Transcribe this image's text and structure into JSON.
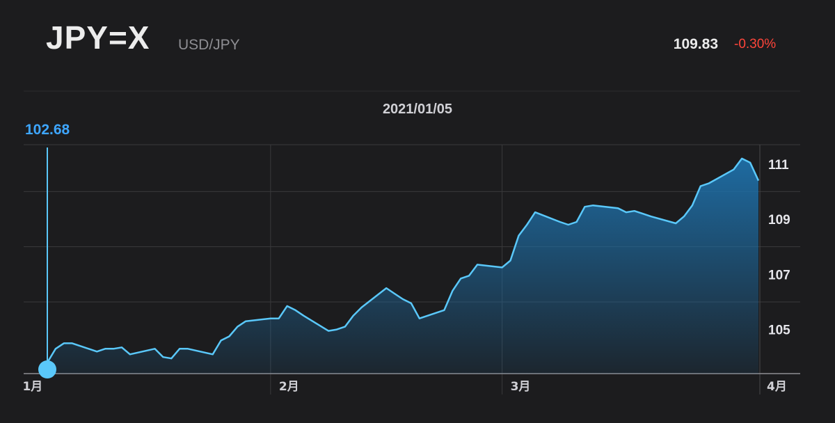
{
  "header": {
    "ticker": "JPY=X",
    "pair": "USD/JPY",
    "price": "109.83",
    "change": "-0.30%"
  },
  "selection": {
    "date": "2021/01/05",
    "value": "102.68"
  },
  "colors": {
    "background": "#1c1c1e",
    "line": "#5ac8fa",
    "fill": "#1e6fa8",
    "marker": "#5ac8fa",
    "negative": "#ff453a",
    "selected_value": "#3ea6ff",
    "grid": "#3a3a3c"
  },
  "chart_data": {
    "type": "area",
    "ylim": [
      103.4,
      111.6
    ],
    "yticks": [
      105,
      107,
      109,
      111
    ],
    "ytick_labels": [
      "105",
      "107",
      "109",
      "111"
    ],
    "xtick_labels": [
      "1月",
      "2月",
      "3月",
      "4月"
    ],
    "xtick_dates": [
      "2021-01-01",
      "2021-02-01",
      "2021-03-01",
      "2021-04-01"
    ],
    "grid": true,
    "legend": "none",
    "series": [
      {
        "x": [
          "2021-01-05",
          "2021-01-06",
          "2021-01-07",
          "2021-01-08",
          "2021-01-11",
          "2021-01-12",
          "2021-01-13",
          "2021-01-14",
          "2021-01-15",
          "2021-01-18",
          "2021-01-19",
          "2021-01-20",
          "2021-01-21",
          "2021-01-22",
          "2021-01-25",
          "2021-01-26",
          "2021-01-27",
          "2021-01-28",
          "2021-01-29",
          "2021-02-01",
          "2021-02-02",
          "2021-02-03",
          "2021-02-04",
          "2021-02-05",
          "2021-02-08",
          "2021-02-09",
          "2021-02-10",
          "2021-02-11",
          "2021-02-12",
          "2021-02-15",
          "2021-02-16",
          "2021-02-17",
          "2021-02-18",
          "2021-02-19",
          "2021-02-22",
          "2021-02-23",
          "2021-02-24",
          "2021-02-25",
          "2021-02-26",
          "2021-03-01",
          "2021-03-02",
          "2021-03-03",
          "2021-03-04",
          "2021-03-05",
          "2021-03-08",
          "2021-03-09",
          "2021-03-10",
          "2021-03-11",
          "2021-03-12",
          "2021-03-15",
          "2021-03-16",
          "2021-03-17",
          "2021-03-18",
          "2021-03-19",
          "2021-03-22",
          "2021-03-23",
          "2021-03-24",
          "2021-03-25",
          "2021-03-26",
          "2021-03-29",
          "2021-03-30",
          "2021-03-31",
          "2021-04-01"
        ],
        "values": [
          103.8,
          104.3,
          104.5,
          104.5,
          104.2,
          104.3,
          104.3,
          104.35,
          104.1,
          104.3,
          104.0,
          103.95,
          104.3,
          104.3,
          104.1,
          104.6,
          104.75,
          105.1,
          105.3,
          105.4,
          105.4,
          105.85,
          105.7,
          105.5,
          104.95,
          105.0,
          105.1,
          105.5,
          105.8,
          106.5,
          106.3,
          106.1,
          105.95,
          105.4,
          105.7,
          106.4,
          106.85,
          106.95,
          107.35,
          107.25,
          107.5,
          108.4,
          108.8,
          109.25,
          108.9,
          108.8,
          108.9,
          109.45,
          109.5,
          109.4,
          109.25,
          109.3,
          109.2,
          109.1,
          108.85,
          109.1,
          109.5,
          110.2,
          110.3,
          110.8,
          111.2,
          111.05,
          110.4
        ]
      }
    ]
  }
}
